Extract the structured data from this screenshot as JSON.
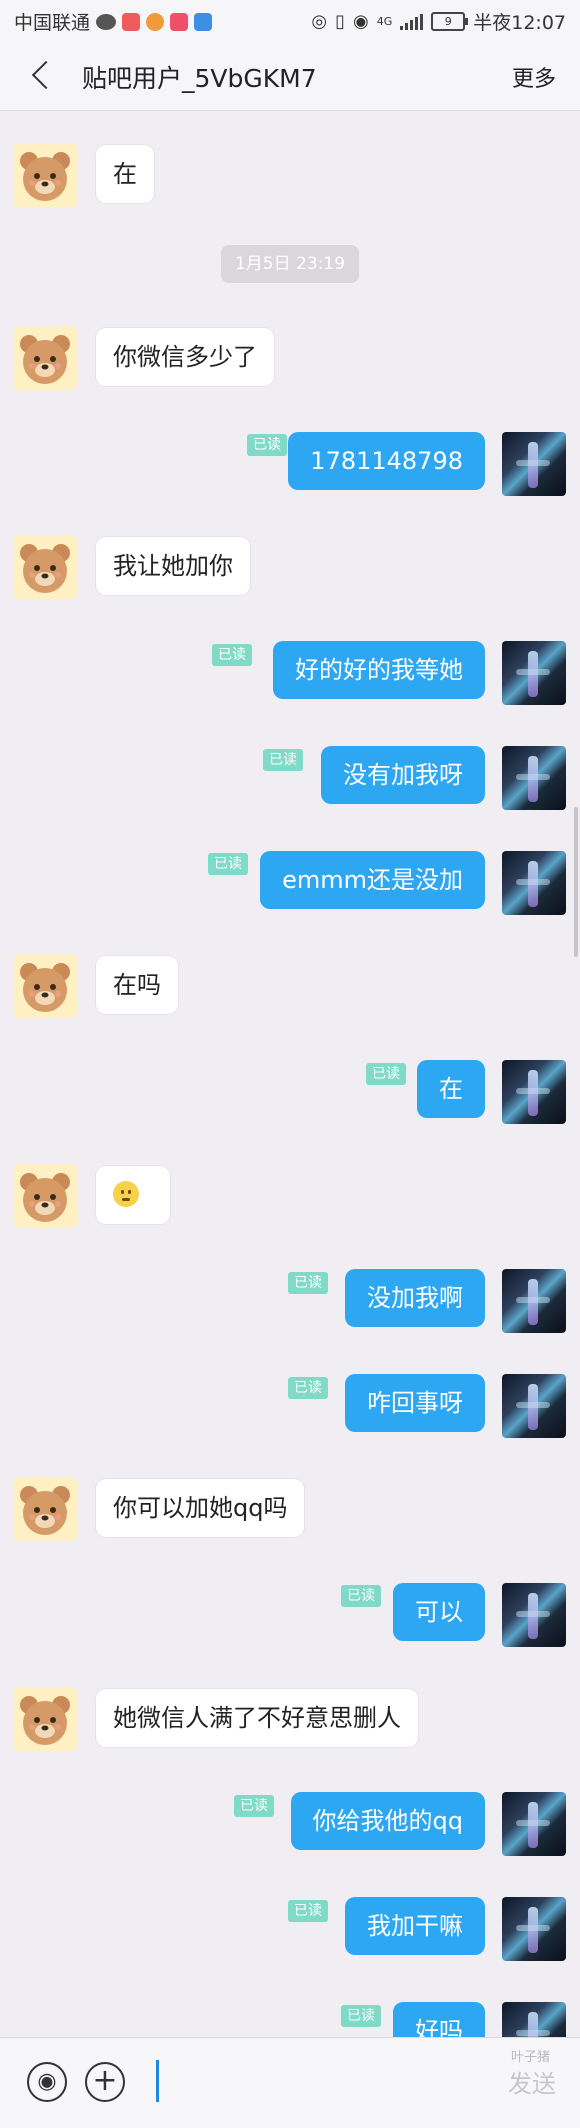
{
  "status_bar": {
    "carrier": "中国联通",
    "network": "4G",
    "battery": "9",
    "time": "半夜12:07"
  },
  "header": {
    "title": "贴吧用户_5VbGKM7",
    "more_label": "更多"
  },
  "chat": {
    "timestamp": "1月5日 23:19",
    "read_label": "已读",
    "messages": [
      {
        "from": "other",
        "text": "在"
      },
      {
        "from": "other",
        "text": "你微信多少了"
      },
      {
        "from": "me",
        "text": "1781148798"
      },
      {
        "from": "other",
        "text": "我让她加你"
      },
      {
        "from": "me",
        "text": "好的好的我等她"
      },
      {
        "from": "me",
        "text": "没有加我呀"
      },
      {
        "from": "me",
        "text": "emmm还是没加"
      },
      {
        "from": "other",
        "text": "在吗"
      },
      {
        "from": "me",
        "text": "在"
      },
      {
        "from": "other",
        "text": "",
        "emoji": "confused-face-emoji"
      },
      {
        "from": "me",
        "text": "没加我啊"
      },
      {
        "from": "me",
        "text": "咋回事呀"
      },
      {
        "from": "other",
        "text": "你可以加她qq吗"
      },
      {
        "from": "me",
        "text": "可以"
      },
      {
        "from": "other",
        "text": "她微信人满了不好意思删人"
      },
      {
        "from": "me",
        "text": "你给我他的qq"
      },
      {
        "from": "me",
        "text": "我加干嘛"
      },
      {
        "from": "me",
        "text": "好吗"
      }
    ]
  },
  "input_bar": {
    "send_label": "发送",
    "watermark": "叶子猪"
  },
  "colors": {
    "outgoing_bubble": "#2ea7f2",
    "read_badge": "#7fdac8",
    "background": "#f1eef3"
  }
}
